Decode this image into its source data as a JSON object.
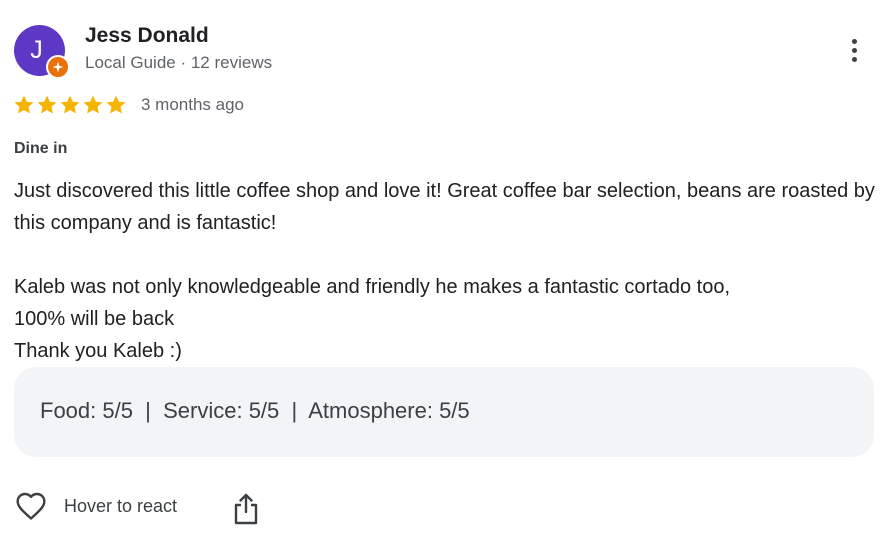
{
  "reviewer": {
    "initial": "J",
    "name": "Jess Donald",
    "subtitle": "Local Guide · 12 reviews",
    "avatar_color": "#5d38c4",
    "badge_color": "#e8710a",
    "badge_icon": "local-guide-badge-icon"
  },
  "review": {
    "rating": 5,
    "max_rating": 5,
    "star_color": "#f4b400",
    "time": "3 months ago",
    "service_type": "Dine in",
    "paragraphs": [
      "Just discovered this little coffee shop and love it! Great coffee bar selection, beans are roasted by this company and is fantastic!",
      "Kaleb was not only knowledgeable and friendly he makes a fantastic cortado too,",
      "100% will be back",
      "Thank you Kaleb :)"
    ],
    "subratings": "Food: 5/5  |  Service: 5/5  |  Atmosphere: 5/5"
  },
  "actions": {
    "react_label": "Hover to react",
    "react_icon": "heart-icon",
    "share_icon": "share-icon",
    "more_icon": "more-vert-icon"
  }
}
